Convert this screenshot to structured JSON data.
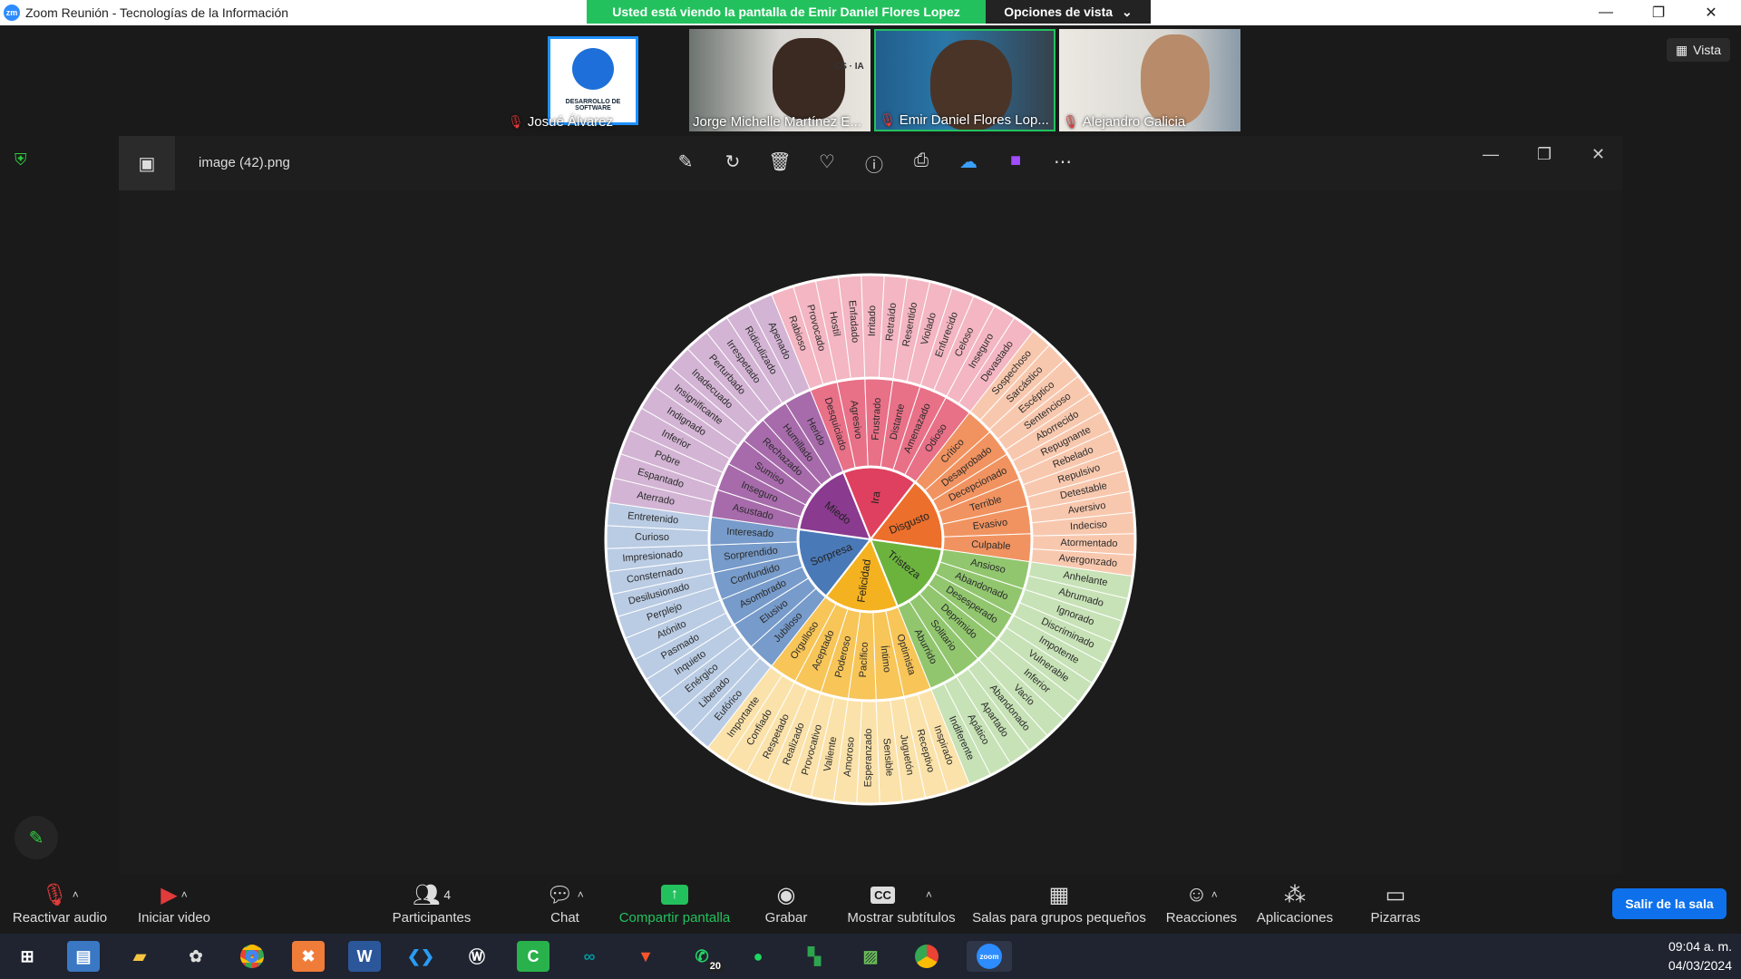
{
  "window": {
    "title": "Zoom Reunión - Tecnologías de la Información"
  },
  "share_banner": {
    "text": "Usted está viendo la pantalla de Emir Daniel Flores Lopez",
    "options": "Opciones de vista"
  },
  "participants": [
    {
      "name": "Josué Álvarez",
      "tile_text": "DESARROLLO DE SOFTWARE"
    },
    {
      "name": "Jorge Michelle Martínez E...",
      "tile_text": "CS · IA"
    },
    {
      "name": "Emir Daniel Flores Lop...",
      "tile_text": ""
    },
    {
      "name": "Alejandro Galicia",
      "tile_text": ""
    }
  ],
  "vista": "Vista",
  "viewer": {
    "filename": "image (42).png"
  },
  "wheel": {
    "core": [
      {
        "label": "Ira",
        "color": "#e0405f"
      },
      {
        "label": "Disgusto",
        "color": "#ec6f2b"
      },
      {
        "label": "Tristeza",
        "color": "#6cb33e"
      },
      {
        "label": "Felicidad",
        "color": "#f4b220"
      },
      {
        "label": "Sorpresa",
        "color": "#4a79b8"
      },
      {
        "label": "Miedo",
        "color": "#8a3a8f"
      }
    ],
    "middle": [
      [
        "Desquiciado",
        "Agresivo",
        "Frustrado",
        "Distante",
        "Amenazado",
        "Odioso"
      ],
      [
        "Crítico",
        "Desaprobado",
        "Decepcionado",
        "Terrible",
        "Evasivo",
        "Culpable"
      ],
      [
        "Ansioso",
        "Abandonado",
        "Desesperado",
        "Deprimido",
        "Solitario",
        "Aburrido"
      ],
      [
        "Optimista",
        "Íntimo",
        "Pacífico",
        "Poderoso",
        "Aceptado",
        "Orgulloso"
      ],
      [
        "Jubiloso",
        "Elusivo",
        "Asombrado",
        "Confundido",
        "Sorprendido",
        "Interesado"
      ],
      [
        "Asustado",
        "Inseguro",
        "Sumiso",
        "Rechazado",
        "Humillado",
        "Herido"
      ]
    ],
    "outer": [
      [
        "Rabioso",
        "Provocado",
        "Hostil",
        "Enfadado",
        "Irritado",
        "Retraído",
        "Resentido",
        "Violado",
        "Enfurecido",
        "Celoso",
        "Inseguro",
        "Devastado"
      ],
      [
        "Sospechoso",
        "Sarcástico",
        "Escéptico",
        "Sentencioso",
        "Aborrecido",
        "Repugnante",
        "Rebelado",
        "Repulsivo",
        "Detestable",
        "Aversivo",
        "Indeciso",
        "Atormentado",
        "Avergonzado"
      ],
      [
        "Anhelante",
        "Abrumado",
        "Ignorado",
        "Discriminado",
        "Impotente",
        "Vulnerable",
        "Inferior",
        "Vacío",
        "Abandonado",
        "Apartado",
        "Apático",
        "Indiferente"
      ],
      [
        "Inspirado",
        "Receptivo",
        "Juguetón",
        "Sensible",
        "Esperanzado",
        "Amoroso",
        "Valiente",
        "Provocativo",
        "Realizado",
        "Respetado",
        "Confiado",
        "Importante"
      ],
      [
        "Eufórico",
        "Liberado",
        "Enérgico",
        "Inquieto",
        "Pasmado",
        "Atónito",
        "Perplejo",
        "Desilusionado",
        "Consternado",
        "Impresionado",
        "Curioso",
        "Entretenido"
      ],
      [
        "Aterrado",
        "Espantado",
        "Pobre",
        "Inferior",
        "Indignado",
        "Insignificante",
        "Inadecuado",
        "Perturbado",
        "Irrespetado",
        "Ridiculizado",
        "Apenado"
      ]
    ]
  },
  "toolbar": [
    {
      "label": "Reactivar audio",
      "icon": "mic-off-icon"
    },
    {
      "label": "Iniciar video",
      "icon": "video-off-icon"
    },
    {
      "label": "Participantes",
      "icon": "participants-icon",
      "count": "4"
    },
    {
      "label": "Chat",
      "icon": "chat-icon"
    },
    {
      "label": "Compartir pantalla",
      "icon": "share-screen-icon"
    },
    {
      "label": "Grabar",
      "icon": "record-icon"
    },
    {
      "label": "Mostrar subtítulos",
      "icon": "cc-icon"
    },
    {
      "label": "Salas para grupos pequeños",
      "icon": "breakout-icon"
    },
    {
      "label": "Reacciones",
      "icon": "reactions-icon"
    },
    {
      "label": "Aplicaciones",
      "icon": "apps-icon"
    },
    {
      "label": "Pizarras",
      "icon": "whiteboard-icon"
    }
  ],
  "leave": "Salir de la sala",
  "taskbar": {
    "time": "09:04 a. m.",
    "date": "04/03/2024",
    "whatsapp_badge": "20"
  },
  "colors": {
    "zoom_blue": "#0e71eb",
    "share_green": "#23c15e"
  }
}
